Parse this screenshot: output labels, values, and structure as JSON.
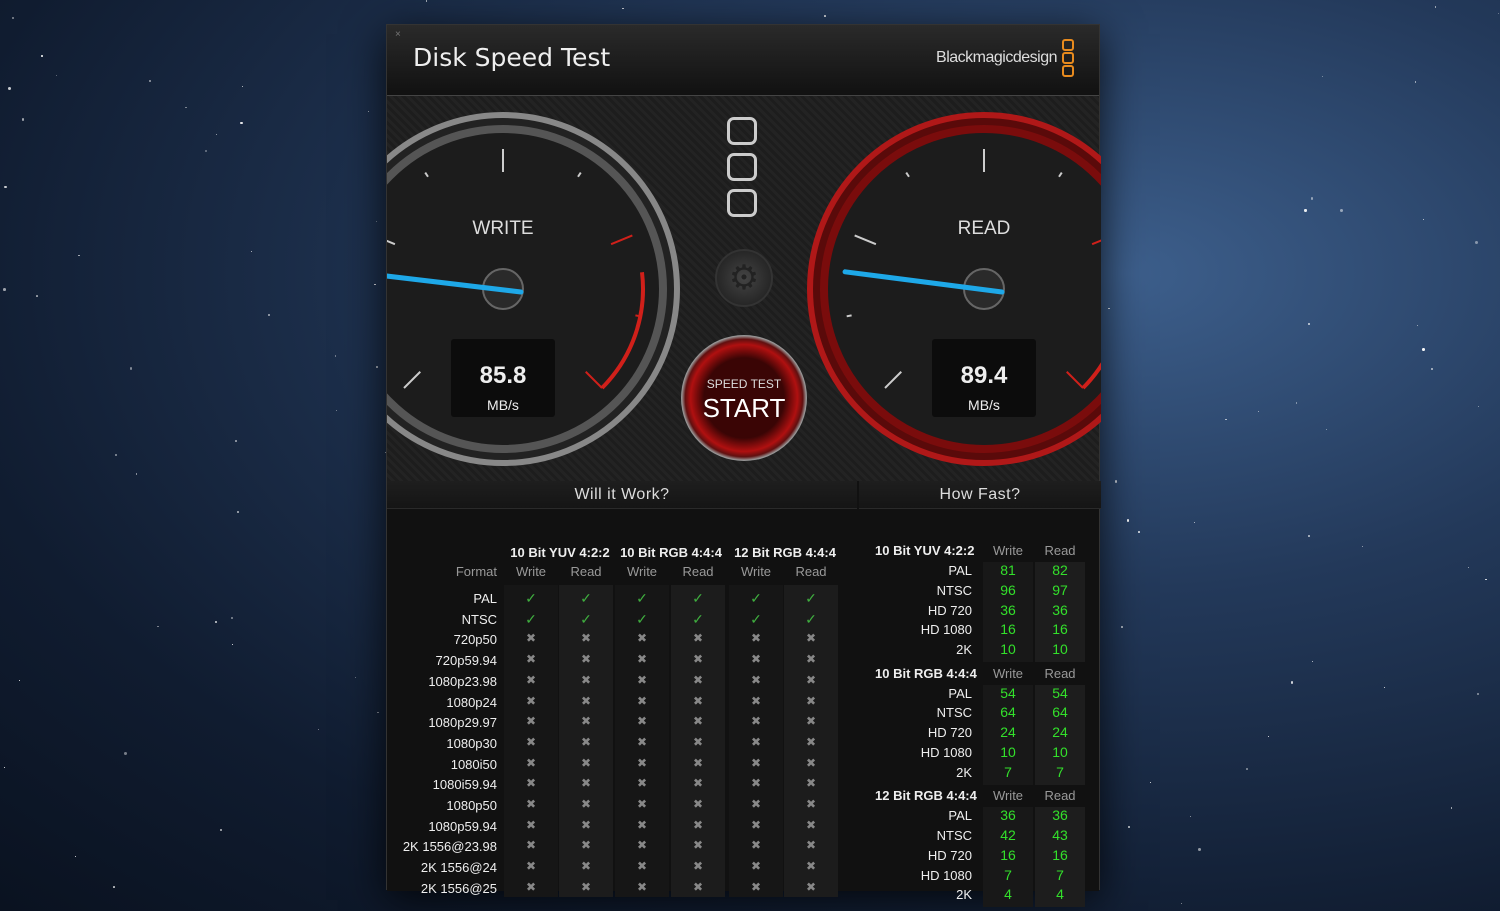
{
  "window": {
    "title": "Disk Speed Test",
    "brand": "Blackmagicdesign",
    "close_icon": "×"
  },
  "colors": {
    "accent": "#e78a1e",
    "needle": "#1ea8e8",
    "green": "#33e02b",
    "red": "#c0181a"
  },
  "gauges": {
    "write": {
      "label": "WRITE",
      "value": "85.8",
      "unit": "MB/s"
    },
    "read": {
      "label": "READ",
      "value": "89.4",
      "unit": "MB/s"
    }
  },
  "start_button": {
    "top": "SPEED TEST",
    "main": "START"
  },
  "settings_icon": "gear-icon",
  "will_it_work": {
    "title": "Will it Work?",
    "format_label": "Format",
    "groups": [
      "10 Bit YUV 4:2:2",
      "10 Bit RGB 4:4:4",
      "12 Bit RGB 4:4:4"
    ],
    "sub": [
      "Write",
      "Read",
      "Write",
      "Read",
      "Write",
      "Read"
    ],
    "rows": [
      {
        "format": "PAL",
        "ok": [
          true,
          true,
          true,
          true,
          true,
          true
        ]
      },
      {
        "format": "NTSC",
        "ok": [
          true,
          true,
          true,
          true,
          true,
          true
        ]
      },
      {
        "format": "720p50",
        "ok": [
          false,
          false,
          false,
          false,
          false,
          false
        ]
      },
      {
        "format": "720p59.94",
        "ok": [
          false,
          false,
          false,
          false,
          false,
          false
        ]
      },
      {
        "format": "1080p23.98",
        "ok": [
          false,
          false,
          false,
          false,
          false,
          false
        ]
      },
      {
        "format": "1080p24",
        "ok": [
          false,
          false,
          false,
          false,
          false,
          false
        ]
      },
      {
        "format": "1080p29.97",
        "ok": [
          false,
          false,
          false,
          false,
          false,
          false
        ]
      },
      {
        "format": "1080p30",
        "ok": [
          false,
          false,
          false,
          false,
          false,
          false
        ]
      },
      {
        "format": "1080i50",
        "ok": [
          false,
          false,
          false,
          false,
          false,
          false
        ]
      },
      {
        "format": "1080i59.94",
        "ok": [
          false,
          false,
          false,
          false,
          false,
          false
        ]
      },
      {
        "format": "1080p50",
        "ok": [
          false,
          false,
          false,
          false,
          false,
          false
        ]
      },
      {
        "format": "1080p59.94",
        "ok": [
          false,
          false,
          false,
          false,
          false,
          false
        ]
      },
      {
        "format": "2K 1556@23.98",
        "ok": [
          false,
          false,
          false,
          false,
          false,
          false
        ]
      },
      {
        "format": "2K 1556@24",
        "ok": [
          false,
          false,
          false,
          false,
          false,
          false
        ]
      },
      {
        "format": "2K 1556@25",
        "ok": [
          false,
          false,
          false,
          false,
          false,
          false
        ]
      }
    ]
  },
  "how_fast": {
    "title": "How Fast?",
    "write_label": "Write",
    "read_label": "Read",
    "groups": [
      {
        "name": "10 Bit YUV 4:2:2",
        "rows": [
          [
            "PAL",
            "81",
            "82"
          ],
          [
            "NTSC",
            "96",
            "97"
          ],
          [
            "HD 720",
            "36",
            "36"
          ],
          [
            "HD 1080",
            "16",
            "16"
          ],
          [
            "2K",
            "10",
            "10"
          ]
        ]
      },
      {
        "name": "10 Bit RGB 4:4:4",
        "rows": [
          [
            "PAL",
            "54",
            "54"
          ],
          [
            "NTSC",
            "64",
            "64"
          ],
          [
            "HD 720",
            "24",
            "24"
          ],
          [
            "HD 1080",
            "10",
            "10"
          ],
          [
            "2K",
            "7",
            "7"
          ]
        ]
      },
      {
        "name": "12 Bit RGB 4:4:4",
        "rows": [
          [
            "PAL",
            "36",
            "36"
          ],
          [
            "NTSC",
            "42",
            "43"
          ],
          [
            "HD 720",
            "16",
            "16"
          ],
          [
            "HD 1080",
            "7",
            "7"
          ],
          [
            "2K",
            "4",
            "4"
          ]
        ]
      }
    ]
  }
}
